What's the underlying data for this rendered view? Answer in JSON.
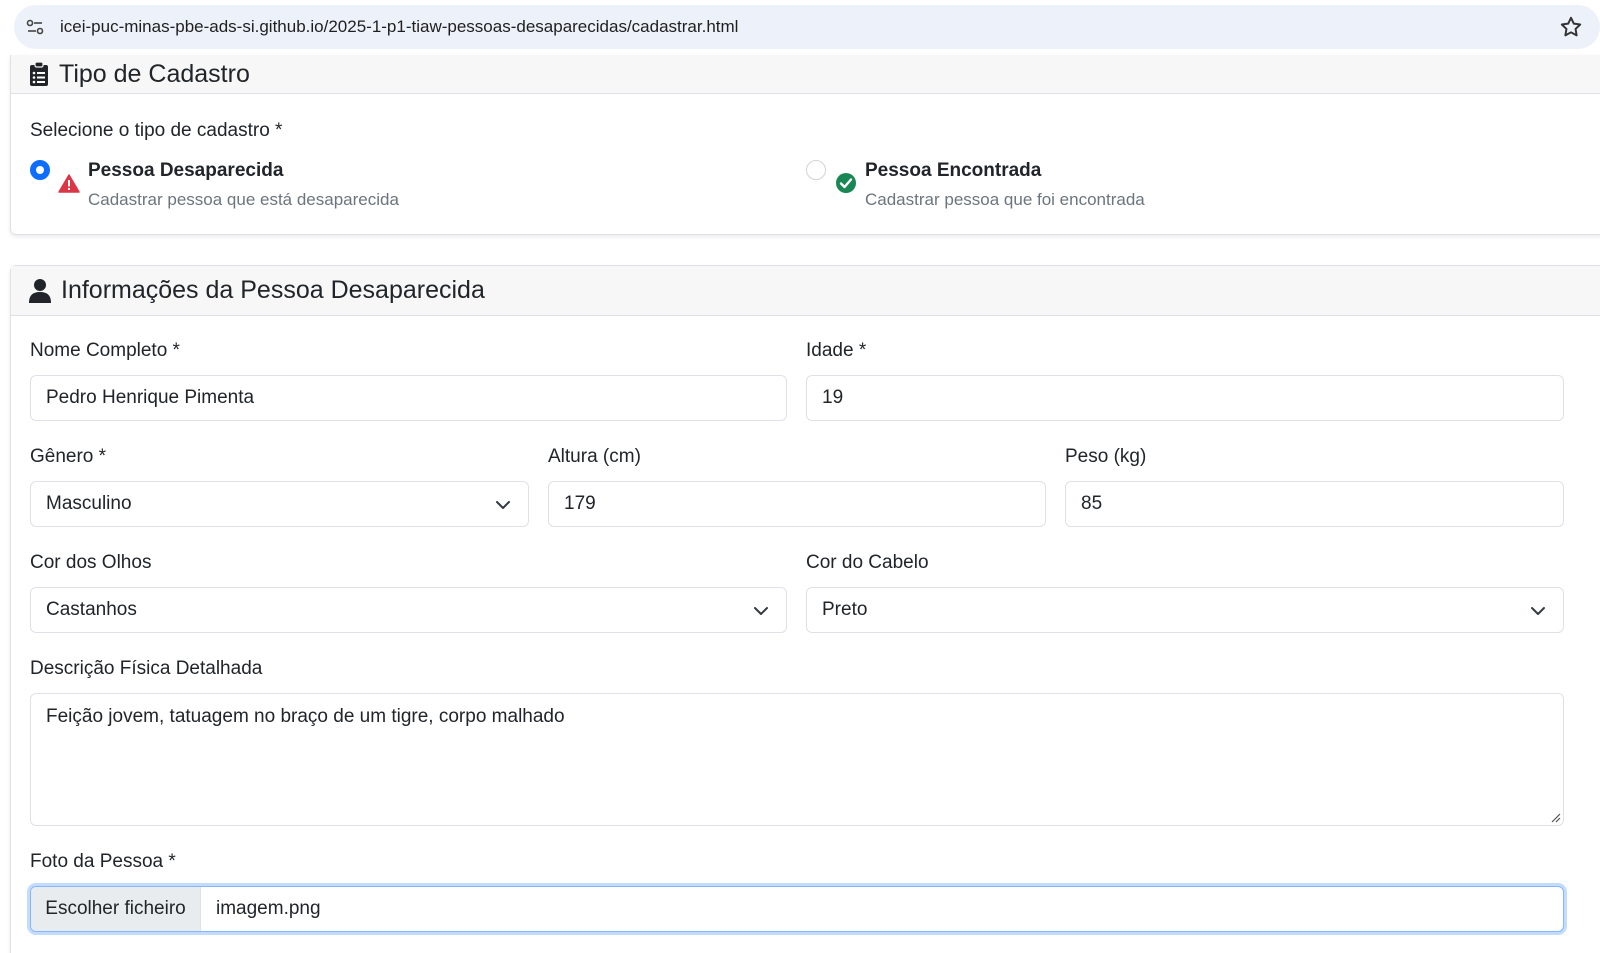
{
  "browser": {
    "url": "icei-puc-minas-pbe-ads-si.github.io/2025-1-p1-tiaw-pessoas-desaparecidas/cadastrar.html"
  },
  "type_card": {
    "title": "Tipo de Cadastro",
    "prompt": "Selecione o tipo de cadastro *",
    "options": [
      {
        "title": "Pessoa Desaparecida",
        "description": "Cadastrar pessoa que está desaparecida",
        "selected": true,
        "icon": "warning-triangle-icon",
        "icon_color": "#dc3545"
      },
      {
        "title": "Pessoa Encontrada",
        "description": "Cadastrar pessoa que foi encontrada",
        "selected": false,
        "icon": "check-circle-icon",
        "icon_color": "#198754"
      }
    ]
  },
  "info_card": {
    "title": "Informações da Pessoa Desaparecida",
    "fields": {
      "nome": {
        "label": "Nome Completo *",
        "value": "Pedro Henrique Pimenta"
      },
      "idade": {
        "label": "Idade *",
        "value": "19"
      },
      "genero": {
        "label": "Gênero *",
        "value": "Masculino"
      },
      "altura": {
        "label": "Altura (cm)",
        "value": "179"
      },
      "peso": {
        "label": "Peso (kg)",
        "value": "85"
      },
      "olhos": {
        "label": "Cor dos Olhos",
        "value": "Castanhos"
      },
      "cabelo": {
        "label": "Cor do Cabelo",
        "value": "Preto"
      },
      "descricao": {
        "label": "Descrição Física Detalhada",
        "value": "Feição jovem, tatuagem no braço de um tigre, corpo malhado"
      },
      "foto": {
        "label": "Foto da Pessoa *",
        "button": "Escolher ficheiro",
        "filename": "imagem.png"
      }
    }
  },
  "colors": {
    "primary": "#0d6efd",
    "danger": "#dc3545",
    "success": "#198754"
  }
}
